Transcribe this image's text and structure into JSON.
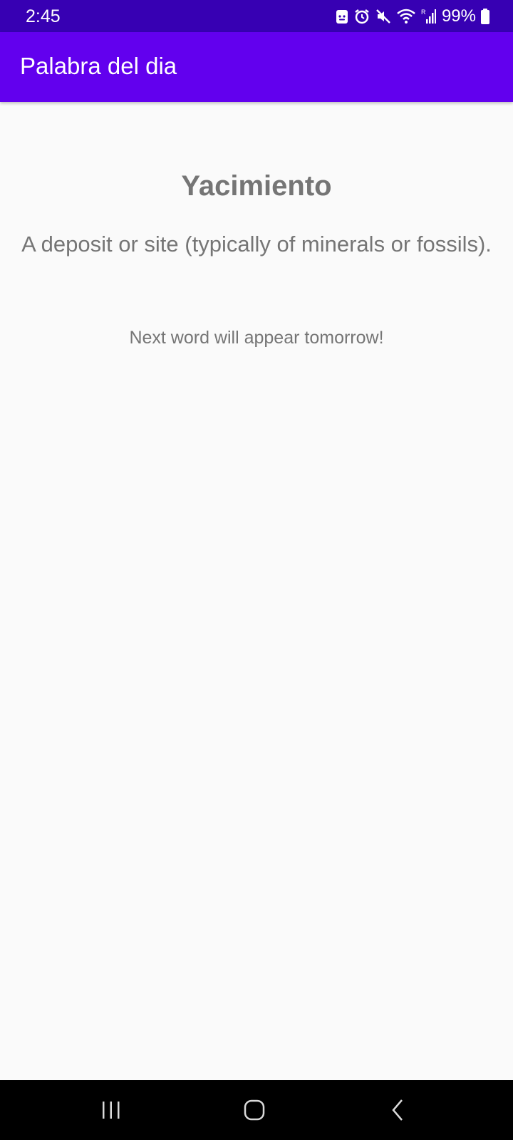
{
  "status_bar": {
    "time": "2:45",
    "battery_percent": "99%",
    "icons": [
      "android-notification-icon",
      "alarm-icon",
      "mute-icon",
      "wifi-icon",
      "signal-icon",
      "battery-icon"
    ]
  },
  "app_bar": {
    "title": "Palabra del dia"
  },
  "content": {
    "word": "Yacimiento",
    "definition": "A deposit or site (typically of minerals or fossils).",
    "next_note": "Next word will appear tomorrow!"
  },
  "nav_bar": {
    "buttons": [
      "recent-apps",
      "home",
      "back"
    ]
  },
  "colors": {
    "status_bar": "#3700b3",
    "app_bar": "#6200ee",
    "background": "#fafafa",
    "text_secondary": "#757575",
    "nav_bar": "#000000"
  }
}
